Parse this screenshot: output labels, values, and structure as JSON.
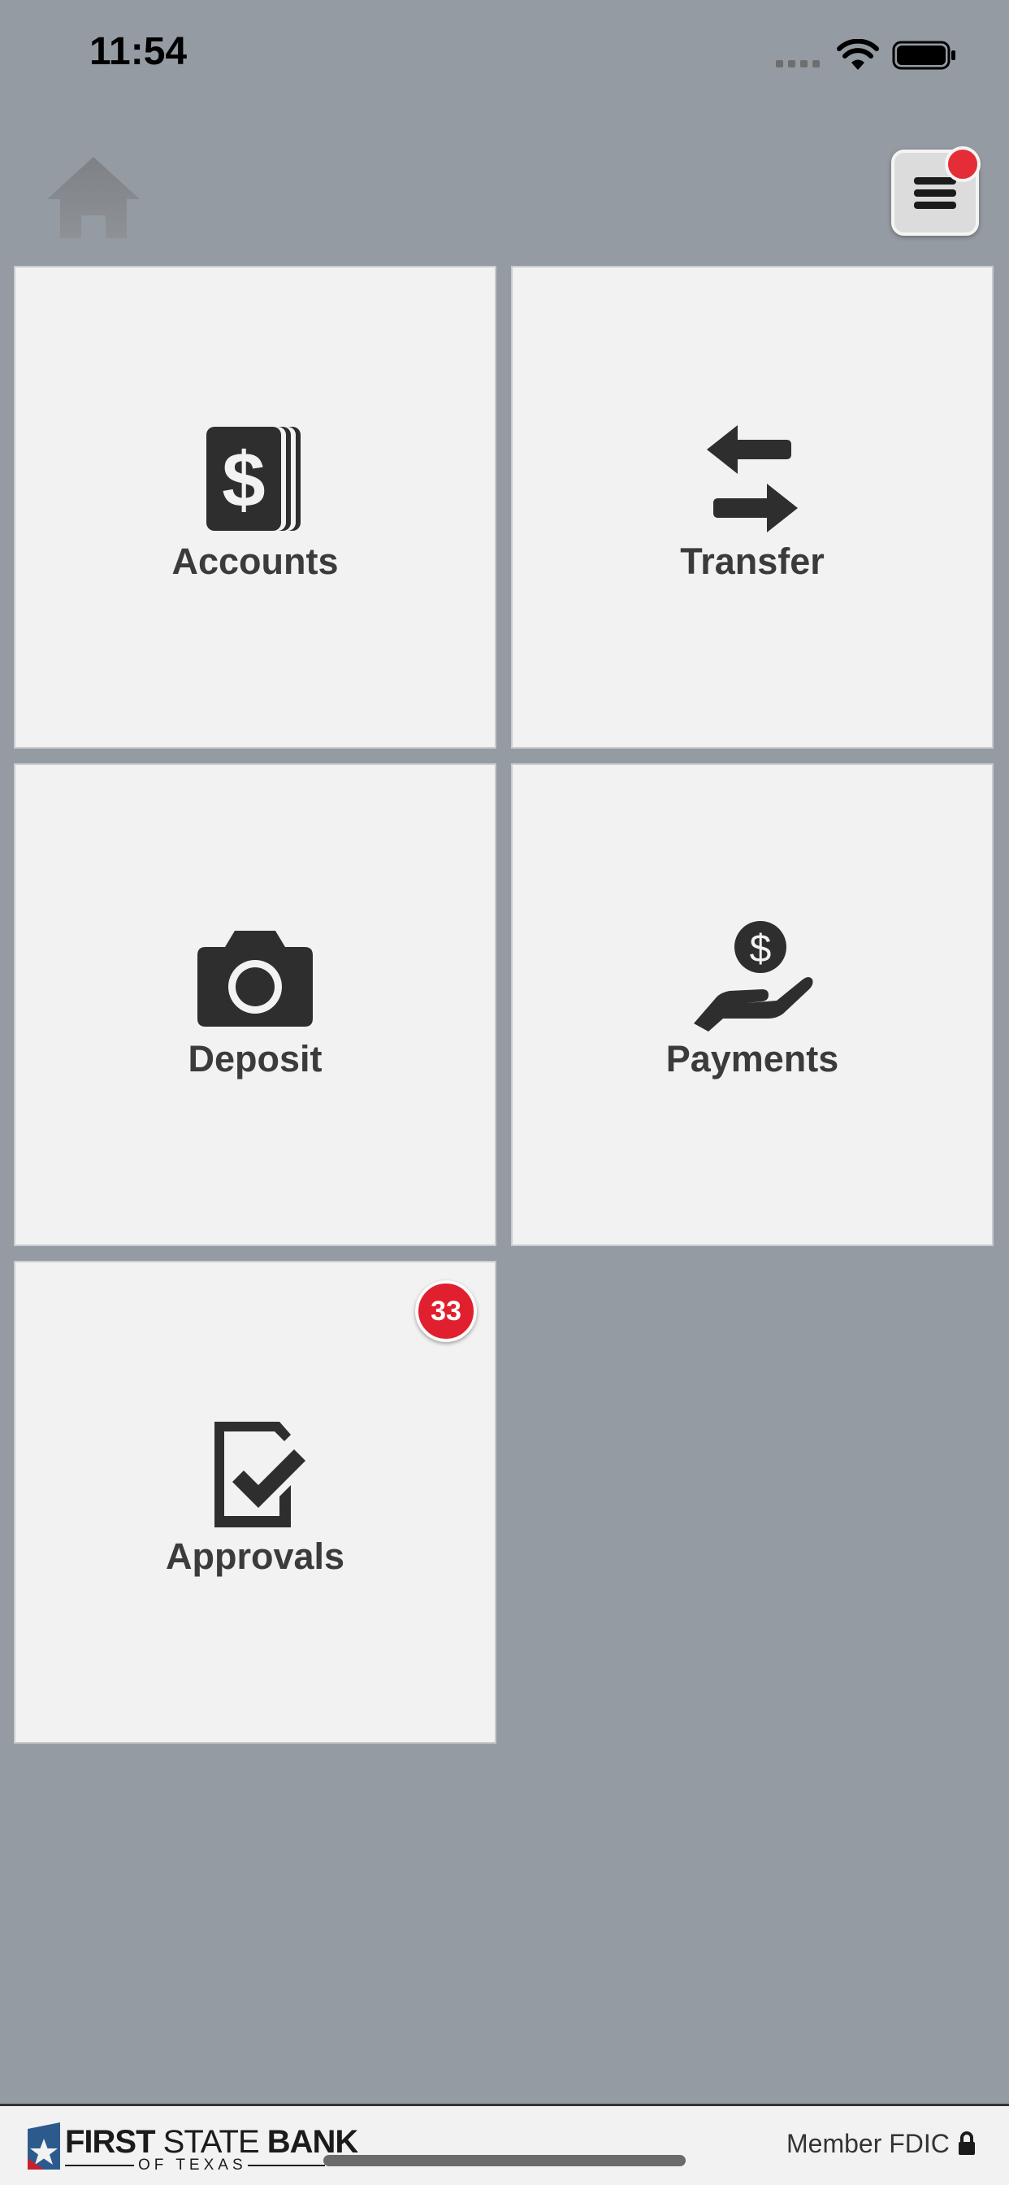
{
  "status_bar": {
    "time": "11:54"
  },
  "header": {
    "home_icon": "home-icon",
    "menu_icon": "hamburger-menu-icon",
    "menu_notification_color": "#e52d38"
  },
  "tiles": [
    {
      "label": "Accounts",
      "icon": "dollar-cards-icon"
    },
    {
      "label": "Transfer",
      "icon": "swap-arrows-icon"
    },
    {
      "label": "Deposit",
      "icon": "camera-icon"
    },
    {
      "label": "Payments",
      "icon": "hand-coin-icon"
    },
    {
      "label": "Approvals",
      "icon": "checklist-icon",
      "badge": "33"
    }
  ],
  "footer": {
    "logo_word1": "FIRST",
    "logo_word2": " STATE ",
    "logo_word3": "BANK",
    "logo_sub": "OF TEXAS",
    "member_text": "Member FDIC",
    "lock_icon": "lock-icon"
  },
  "colors": {
    "background": "#959ba2",
    "tile": "#f2f2f2",
    "icon": "#2e2e2e",
    "badge": "#e0202e"
  }
}
